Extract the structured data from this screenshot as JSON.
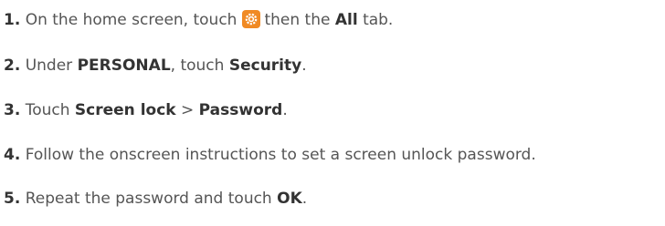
{
  "steps": [
    {
      "number": "1.",
      "text_a": "On the home screen, touch",
      "icon": "settings-gear-icon",
      "text_b": "then the",
      "bold_a": "All",
      "text_c": "tab."
    },
    {
      "number": "2.",
      "text_a": "Under",
      "bold_a": "PERSONAL",
      "text_b": ", touch",
      "bold_b": "Security",
      "text_c": "."
    },
    {
      "number": "3.",
      "text_a": "Touch",
      "bold_a": "Screen lock",
      "text_b": ">",
      "bold_b": "Password",
      "text_c": "."
    },
    {
      "number": "4.",
      "text_a": "Follow the onscreen instructions to set a screen unlock password."
    },
    {
      "number": "5.",
      "text_a": "Repeat the password and touch",
      "bold_a": "OK",
      "text_b": "."
    }
  ],
  "colors": {
    "text": "#555555",
    "bold": "#333333",
    "icon_bg": "#f08a24"
  }
}
